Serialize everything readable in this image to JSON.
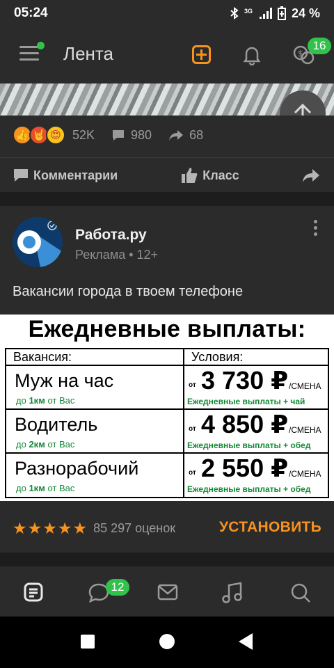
{
  "status_bar": {
    "time": "05:24",
    "network": "3G",
    "battery": "24 %"
  },
  "app_bar": {
    "title": "Лента",
    "notifications_badge": "16"
  },
  "post": {
    "reactions_count": "52K",
    "comments_count": "980",
    "shares_count": "68",
    "actions": {
      "comments": "Комментарии",
      "like": "Класс"
    }
  },
  "ad": {
    "advertiser": "Работа.ру",
    "label": "Реклама • 12+",
    "text": "Вакансии города в твоем телефоне",
    "banner": {
      "title": "Ежедневные выплаты:",
      "col_vacancy": "Вакансия:",
      "col_conditions": "Условия:",
      "price_prefix": "от",
      "price_unit": "/СМЕНА",
      "rows": [
        {
          "job": "Муж на час",
          "dist_pre": "до",
          "dist": "1км",
          "dist_post": "от Вас",
          "price": "3 730 ₽",
          "cond": "Ежедневные выплаты + чай"
        },
        {
          "job": "Водитель",
          "dist_pre": "до",
          "dist": "2км",
          "dist_post": "от Вас",
          "price": "4 850 ₽",
          "cond": "Ежедневные выплаты + обед"
        },
        {
          "job": "Разнорабочий",
          "dist_pre": "до",
          "dist": "1км",
          "dist_post": "от Вас",
          "price": "2 550 ₽",
          "cond": "Ежедневные выплаты + обед"
        }
      ]
    },
    "rating": {
      "stars": 5,
      "count": "85 297 оценок"
    },
    "install": "УСТАНОВИТЬ"
  },
  "tab_bar": {
    "messages_badge": "12"
  },
  "colors": {
    "accent": "#f7931e",
    "badge": "#31c24b",
    "card": "#2b2b2b",
    "green_text": "#138a36"
  },
  "icons": [
    "menu-icon",
    "add-icon",
    "bell-icon",
    "money-icon",
    "arrow-up-icon",
    "comment-icon",
    "like-icon",
    "share-icon",
    "feed-icon",
    "chat-icon",
    "mail-icon",
    "music-icon",
    "search-icon"
  ]
}
